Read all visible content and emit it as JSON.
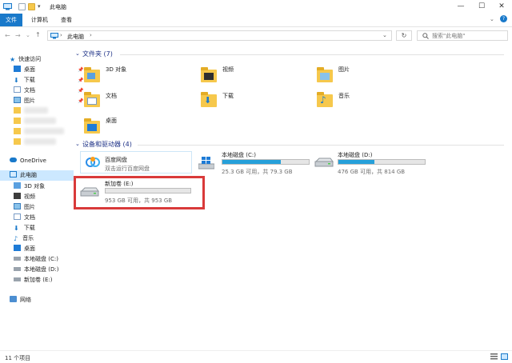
{
  "window": {
    "title": "此电脑",
    "minimize": "—",
    "maximize": "☐",
    "close": "✕"
  },
  "ribbon": {
    "tabs": [
      {
        "label": "文件",
        "active": true
      },
      {
        "label": "计算机",
        "active": false
      },
      {
        "label": "查看",
        "active": false
      }
    ]
  },
  "address": {
    "path": "此电脑",
    "search_placeholder": "搜索\"此电脑\""
  },
  "nav": {
    "quick_access": "快速访问",
    "quick_items": [
      "桌面",
      "下载",
      "文档",
      "图片"
    ],
    "onedrive": "OneDrive",
    "this_pc": "此电脑",
    "pc_items": [
      "3D 对象",
      "视频",
      "图片",
      "文档",
      "下载",
      "音乐",
      "桌面",
      "本地磁盘 (C:)",
      "本地磁盘 (D:)",
      "新加卷 (E:)"
    ],
    "network": "网络"
  },
  "folders": {
    "header": "文件夹 (7)",
    "items": [
      "3D 对象",
      "视频",
      "图片",
      "文档",
      "下载",
      "音乐",
      "桌面"
    ]
  },
  "devices": {
    "header": "设备和驱动器 (4)",
    "baidu": {
      "name": "百度网盘",
      "sub": "双击运行百度网盘"
    },
    "drive_c": {
      "name": "本地磁盘 (C:)",
      "sub": "25.3 GB 可用，共 79.3 GB",
      "used_fraction": 0.68
    },
    "drive_d": {
      "name": "本地磁盘 (D:)",
      "sub": "476 GB 可用，共 814 GB",
      "used_fraction": 0.42
    },
    "drive_e": {
      "name": "新加卷 (E:)",
      "sub": "953 GB 可用，共 953 GB",
      "used_fraction": 0.0
    }
  },
  "status": {
    "count": "11 个项目"
  },
  "colors": {
    "accent": "#1979ca",
    "highlight": "#d93a3a",
    "bar_fill": "#26a0da"
  }
}
